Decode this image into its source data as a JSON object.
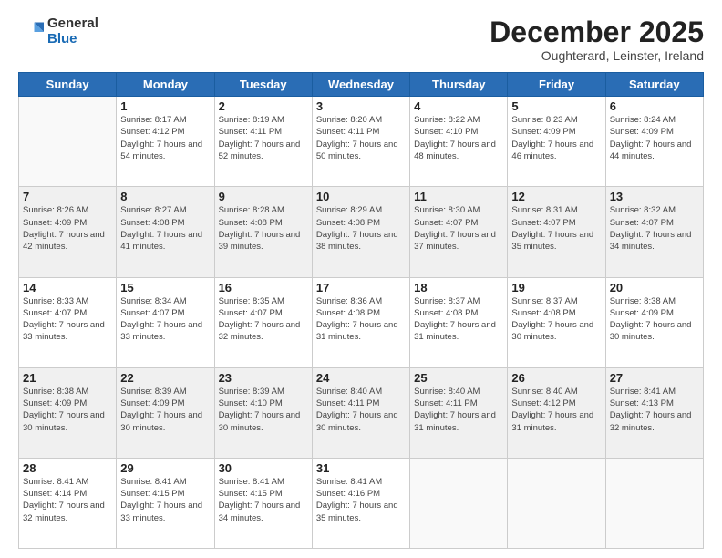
{
  "logo": {
    "general": "General",
    "blue": "Blue"
  },
  "header": {
    "month": "December 2025",
    "location": "Oughterard, Leinster, Ireland"
  },
  "days_of_week": [
    "Sunday",
    "Monday",
    "Tuesday",
    "Wednesday",
    "Thursday",
    "Friday",
    "Saturday"
  ],
  "weeks": [
    [
      {
        "day": "",
        "sunrise": "",
        "sunset": "",
        "daylight": ""
      },
      {
        "day": "1",
        "sunrise": "Sunrise: 8:17 AM",
        "sunset": "Sunset: 4:12 PM",
        "daylight": "Daylight: 7 hours and 54 minutes."
      },
      {
        "day": "2",
        "sunrise": "Sunrise: 8:19 AM",
        "sunset": "Sunset: 4:11 PM",
        "daylight": "Daylight: 7 hours and 52 minutes."
      },
      {
        "day": "3",
        "sunrise": "Sunrise: 8:20 AM",
        "sunset": "Sunset: 4:11 PM",
        "daylight": "Daylight: 7 hours and 50 minutes."
      },
      {
        "day": "4",
        "sunrise": "Sunrise: 8:22 AM",
        "sunset": "Sunset: 4:10 PM",
        "daylight": "Daylight: 7 hours and 48 minutes."
      },
      {
        "day": "5",
        "sunrise": "Sunrise: 8:23 AM",
        "sunset": "Sunset: 4:09 PM",
        "daylight": "Daylight: 7 hours and 46 minutes."
      },
      {
        "day": "6",
        "sunrise": "Sunrise: 8:24 AM",
        "sunset": "Sunset: 4:09 PM",
        "daylight": "Daylight: 7 hours and 44 minutes."
      }
    ],
    [
      {
        "day": "7",
        "sunrise": "Sunrise: 8:26 AM",
        "sunset": "Sunset: 4:09 PM",
        "daylight": "Daylight: 7 hours and 42 minutes."
      },
      {
        "day": "8",
        "sunrise": "Sunrise: 8:27 AM",
        "sunset": "Sunset: 4:08 PM",
        "daylight": "Daylight: 7 hours and 41 minutes."
      },
      {
        "day": "9",
        "sunrise": "Sunrise: 8:28 AM",
        "sunset": "Sunset: 4:08 PM",
        "daylight": "Daylight: 7 hours and 39 minutes."
      },
      {
        "day": "10",
        "sunrise": "Sunrise: 8:29 AM",
        "sunset": "Sunset: 4:08 PM",
        "daylight": "Daylight: 7 hours and 38 minutes."
      },
      {
        "day": "11",
        "sunrise": "Sunrise: 8:30 AM",
        "sunset": "Sunset: 4:07 PM",
        "daylight": "Daylight: 7 hours and 37 minutes."
      },
      {
        "day": "12",
        "sunrise": "Sunrise: 8:31 AM",
        "sunset": "Sunset: 4:07 PM",
        "daylight": "Daylight: 7 hours and 35 minutes."
      },
      {
        "day": "13",
        "sunrise": "Sunrise: 8:32 AM",
        "sunset": "Sunset: 4:07 PM",
        "daylight": "Daylight: 7 hours and 34 minutes."
      }
    ],
    [
      {
        "day": "14",
        "sunrise": "Sunrise: 8:33 AM",
        "sunset": "Sunset: 4:07 PM",
        "daylight": "Daylight: 7 hours and 33 minutes."
      },
      {
        "day": "15",
        "sunrise": "Sunrise: 8:34 AM",
        "sunset": "Sunset: 4:07 PM",
        "daylight": "Daylight: 7 hours and 33 minutes."
      },
      {
        "day": "16",
        "sunrise": "Sunrise: 8:35 AM",
        "sunset": "Sunset: 4:07 PM",
        "daylight": "Daylight: 7 hours and 32 minutes."
      },
      {
        "day": "17",
        "sunrise": "Sunrise: 8:36 AM",
        "sunset": "Sunset: 4:08 PM",
        "daylight": "Daylight: 7 hours and 31 minutes."
      },
      {
        "day": "18",
        "sunrise": "Sunrise: 8:37 AM",
        "sunset": "Sunset: 4:08 PM",
        "daylight": "Daylight: 7 hours and 31 minutes."
      },
      {
        "day": "19",
        "sunrise": "Sunrise: 8:37 AM",
        "sunset": "Sunset: 4:08 PM",
        "daylight": "Daylight: 7 hours and 30 minutes."
      },
      {
        "day": "20",
        "sunrise": "Sunrise: 8:38 AM",
        "sunset": "Sunset: 4:09 PM",
        "daylight": "Daylight: 7 hours and 30 minutes."
      }
    ],
    [
      {
        "day": "21",
        "sunrise": "Sunrise: 8:38 AM",
        "sunset": "Sunset: 4:09 PM",
        "daylight": "Daylight: 7 hours and 30 minutes."
      },
      {
        "day": "22",
        "sunrise": "Sunrise: 8:39 AM",
        "sunset": "Sunset: 4:09 PM",
        "daylight": "Daylight: 7 hours and 30 minutes."
      },
      {
        "day": "23",
        "sunrise": "Sunrise: 8:39 AM",
        "sunset": "Sunset: 4:10 PM",
        "daylight": "Daylight: 7 hours and 30 minutes."
      },
      {
        "day": "24",
        "sunrise": "Sunrise: 8:40 AM",
        "sunset": "Sunset: 4:11 PM",
        "daylight": "Daylight: 7 hours and 30 minutes."
      },
      {
        "day": "25",
        "sunrise": "Sunrise: 8:40 AM",
        "sunset": "Sunset: 4:11 PM",
        "daylight": "Daylight: 7 hours and 31 minutes."
      },
      {
        "day": "26",
        "sunrise": "Sunrise: 8:40 AM",
        "sunset": "Sunset: 4:12 PM",
        "daylight": "Daylight: 7 hours and 31 minutes."
      },
      {
        "day": "27",
        "sunrise": "Sunrise: 8:41 AM",
        "sunset": "Sunset: 4:13 PM",
        "daylight": "Daylight: 7 hours and 32 minutes."
      }
    ],
    [
      {
        "day": "28",
        "sunrise": "Sunrise: 8:41 AM",
        "sunset": "Sunset: 4:14 PM",
        "daylight": "Daylight: 7 hours and 32 minutes."
      },
      {
        "day": "29",
        "sunrise": "Sunrise: 8:41 AM",
        "sunset": "Sunset: 4:15 PM",
        "daylight": "Daylight: 7 hours and 33 minutes."
      },
      {
        "day": "30",
        "sunrise": "Sunrise: 8:41 AM",
        "sunset": "Sunset: 4:15 PM",
        "daylight": "Daylight: 7 hours and 34 minutes."
      },
      {
        "day": "31",
        "sunrise": "Sunrise: 8:41 AM",
        "sunset": "Sunset: 4:16 PM",
        "daylight": "Daylight: 7 hours and 35 minutes."
      },
      {
        "day": "",
        "sunrise": "",
        "sunset": "",
        "daylight": ""
      },
      {
        "day": "",
        "sunrise": "",
        "sunset": "",
        "daylight": ""
      },
      {
        "day": "",
        "sunrise": "",
        "sunset": "",
        "daylight": ""
      }
    ]
  ]
}
